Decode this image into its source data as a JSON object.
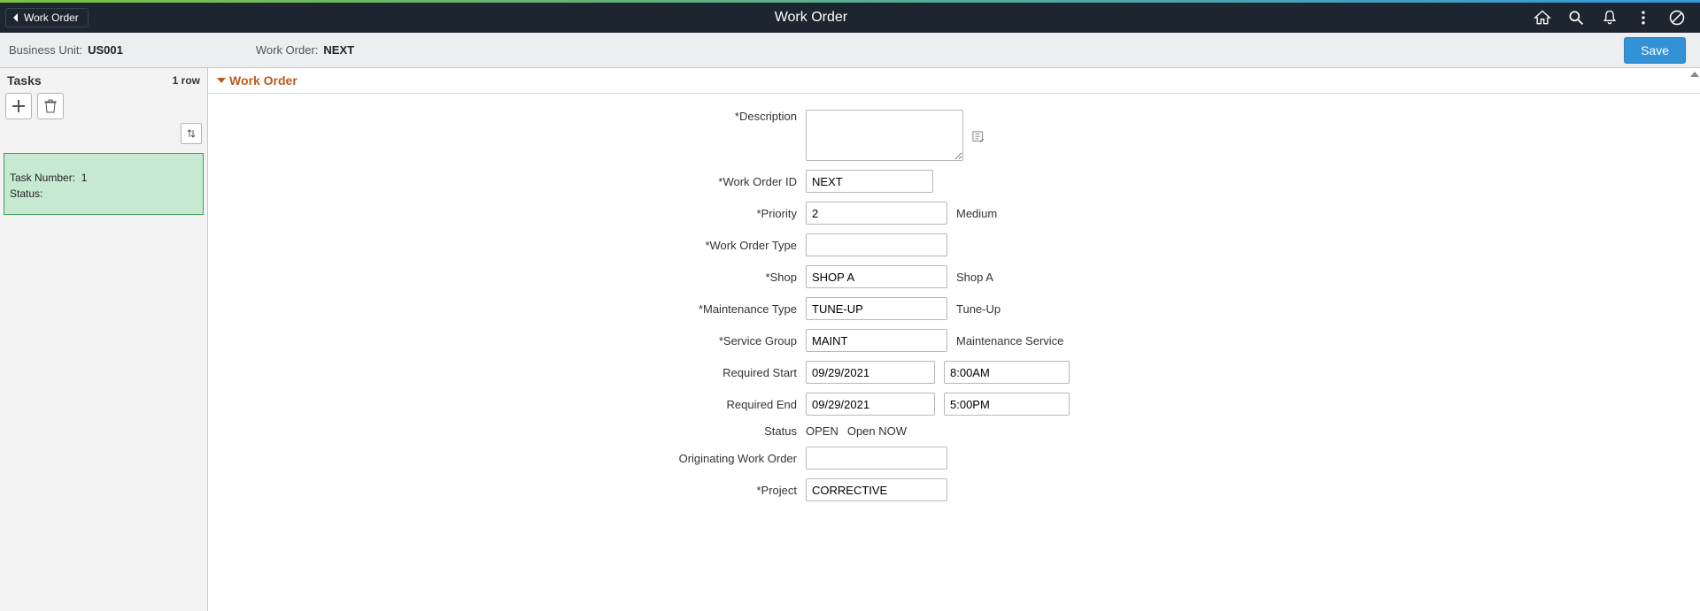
{
  "header": {
    "back_label": "Work Order",
    "title": "Work Order",
    "save_label": "Save"
  },
  "sub": {
    "bu_label": "Business Unit:",
    "bu_value": "US001",
    "wo_label": "Work Order:",
    "wo_value": "NEXT"
  },
  "tasks": {
    "title": "Tasks",
    "count_label": "1 row",
    "card_task_number_label": "Task Number:",
    "card_task_number_value": "1",
    "card_status_label": "Status:",
    "card_status_value": ""
  },
  "section": {
    "title": "Work Order"
  },
  "form": {
    "description_label": "*Description",
    "description_value": "",
    "wo_id_label": "*Work Order ID",
    "wo_id_value": "NEXT",
    "priority_label": "*Priority",
    "priority_value": "2",
    "priority_desc": "Medium",
    "wo_type_label": "*Work Order Type",
    "wo_type_value": "",
    "shop_label": "*Shop",
    "shop_value": "SHOP A",
    "shop_desc": "Shop A",
    "maint_type_label": "*Maintenance Type",
    "maint_type_value": "TUNE-UP",
    "maint_type_desc": "Tune-Up",
    "svc_group_label": "*Service Group",
    "svc_group_value": "MAINT",
    "svc_group_desc": "Maintenance Service",
    "req_start_label": "Required Start",
    "req_start_date": "09/29/2021",
    "req_start_time": "8:00AM",
    "req_end_label": "Required End",
    "req_end_date": "09/29/2021",
    "req_end_time": "5:00PM",
    "status_label": "Status",
    "status_code": "OPEN",
    "status_desc": "Open NOW",
    "orig_wo_label": "Originating Work Order",
    "orig_wo_value": "",
    "project_label": "*Project",
    "project_value": "CORRECTIVE"
  }
}
